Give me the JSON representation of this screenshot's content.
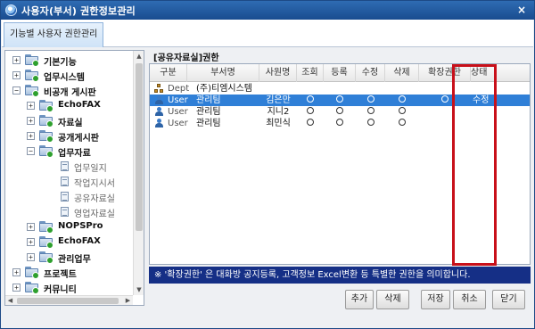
{
  "window": {
    "title": "사용자(부서) 권한정보관리",
    "close_symbol": "×"
  },
  "tabs": [
    {
      "label": "기능별 사용자 권한관리"
    }
  ],
  "tree": {
    "items": [
      {
        "label": "기본기능",
        "expander": "+",
        "bold": true
      },
      {
        "label": "업무시스템",
        "expander": "+",
        "bold": true
      },
      {
        "label": "비공개 게시판",
        "expander": "−",
        "bold": true
      },
      {
        "label": "EchoFAX",
        "expander": "+",
        "bold": true
      },
      {
        "label": "자료실",
        "expander": "+",
        "bold": true
      },
      {
        "label": "공개게시판",
        "expander": "+",
        "bold": true
      },
      {
        "label": "업무자료",
        "expander": "−",
        "bold": true
      },
      {
        "label": "업무일지",
        "expander": "",
        "bold": false
      },
      {
        "label": "작업지시서",
        "expander": "",
        "bold": false
      },
      {
        "label": "공유자료실",
        "expander": "",
        "bold": false
      },
      {
        "label": "영업자료실",
        "expander": "",
        "bold": false
      },
      {
        "label": "NOPSPro",
        "expander": "+",
        "bold": true
      },
      {
        "label": "EchoFAX",
        "expander": "+",
        "bold": true
      },
      {
        "label": "관리업무",
        "expander": "+",
        "bold": true
      },
      {
        "label": "프로젝트",
        "expander": "+",
        "bold": true
      },
      {
        "label": "커뮤니티",
        "expander": "+",
        "bold": true
      }
    ]
  },
  "grid": {
    "title": "[공유자료실]권한",
    "columns": [
      "구분",
      "부서명",
      "사원명",
      "조회",
      "등록",
      "수정",
      "삭제",
      "확장권한",
      "상태"
    ],
    "rows": [
      {
        "type": "Dept",
        "icon": "dept-icon",
        "dept": "(주)티엠시스템",
        "name": "",
        "view": false,
        "reg": false,
        "edit": false,
        "del": false,
        "ext": false,
        "status": ""
      },
      {
        "type": "User",
        "icon": "user-icon",
        "dept": "관리팀",
        "name": "김은만",
        "view": true,
        "reg": true,
        "edit": true,
        "del": true,
        "ext": true,
        "status": "수정"
      },
      {
        "type": "User",
        "icon": "user-icon",
        "dept": "관리팀",
        "name": "지니2",
        "view": true,
        "reg": true,
        "edit": true,
        "del": true,
        "ext": false,
        "status": ""
      },
      {
        "type": "User",
        "icon": "user-icon",
        "dept": "관리팀",
        "name": "최민식",
        "view": true,
        "reg": true,
        "edit": true,
        "del": true,
        "ext": false,
        "status": ""
      }
    ],
    "selected_row": 1
  },
  "notice": "※ '확장권한' 은 대화방 공지등록, 고객정보 Excel변환 등 특별한 권한을 의미합니다.",
  "buttons": {
    "add": "추가",
    "delete": "삭제",
    "save": "저장",
    "cancel": "취소",
    "close": "닫기"
  },
  "colors": {
    "title_bar": "#1a4c8f",
    "selection": "#2f7fd7",
    "notice_bg": "#152f86",
    "highlight": "#c8101a"
  }
}
